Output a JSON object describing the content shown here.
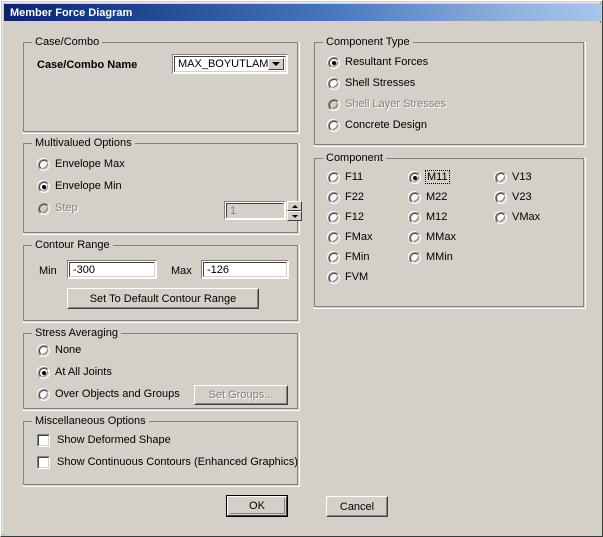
{
  "window": {
    "title": "Member Force Diagram"
  },
  "case_combo": {
    "group_title": "Case/Combo",
    "name_label": "Case/Combo Name",
    "selected_value": "MAX_BOYUTLAMA",
    "dropdown_icon": "chevron-down-icon"
  },
  "multivalued": {
    "group_title": "Multivalued Options",
    "options": [
      {
        "label": "Envelope Max",
        "selected": false,
        "disabled": false
      },
      {
        "label": "Envelope Min",
        "selected": true,
        "disabled": false
      },
      {
        "label": "Step",
        "selected": false,
        "disabled": true
      }
    ],
    "step_value": "1",
    "spinner_up_icon": "triangle-up-icon",
    "spinner_down_icon": "triangle-down-icon"
  },
  "contour_range": {
    "group_title": "Contour Range",
    "min_label": "Min",
    "min_value": "-300",
    "max_label": "Max",
    "max_value": "-126",
    "default_button": "Set To Default Contour Range"
  },
  "stress_averaging": {
    "group_title": "Stress Averaging",
    "options": [
      {
        "label": "None",
        "selected": false
      },
      {
        "label": "At All Joints",
        "selected": true
      },
      {
        "label": "Over Objects and Groups",
        "selected": false
      }
    ],
    "set_groups_button": "Set Groups...",
    "set_groups_disabled": true
  },
  "misc_options": {
    "group_title": "Miscellaneous Options",
    "items": [
      {
        "label": "Show Deformed Shape",
        "checked": false
      },
      {
        "label": "Show Continuous Contours  (Enhanced Graphics)",
        "checked": false
      }
    ]
  },
  "component_type": {
    "group_title": "Component Type",
    "options": [
      {
        "label": "Resultant Forces",
        "selected": true,
        "disabled": false
      },
      {
        "label": "Shell Stresses",
        "selected": false,
        "disabled": false
      },
      {
        "label": "Shell Layer Stresses",
        "selected": false,
        "disabled": true
      },
      {
        "label": "Concrete Design",
        "selected": false,
        "disabled": false
      }
    ]
  },
  "component": {
    "group_title": "Component",
    "column1": [
      {
        "label": "F11",
        "selected": false
      },
      {
        "label": "F22",
        "selected": false
      },
      {
        "label": "F12",
        "selected": false
      },
      {
        "label": "FMax",
        "selected": false
      },
      {
        "label": "FMin",
        "selected": false
      },
      {
        "label": "FVM",
        "selected": false
      }
    ],
    "column2": [
      {
        "label": "M11",
        "selected": true,
        "focused": true
      },
      {
        "label": "M22",
        "selected": false
      },
      {
        "label": "M12",
        "selected": false
      },
      {
        "label": "MMax",
        "selected": false
      },
      {
        "label": "MMin",
        "selected": false
      }
    ],
    "column3": [
      {
        "label": "V13",
        "selected": false
      },
      {
        "label": "V23",
        "selected": false
      },
      {
        "label": "VMax",
        "selected": false
      }
    ]
  },
  "footer": {
    "ok_label": "OK",
    "cancel_label": "Cancel"
  }
}
